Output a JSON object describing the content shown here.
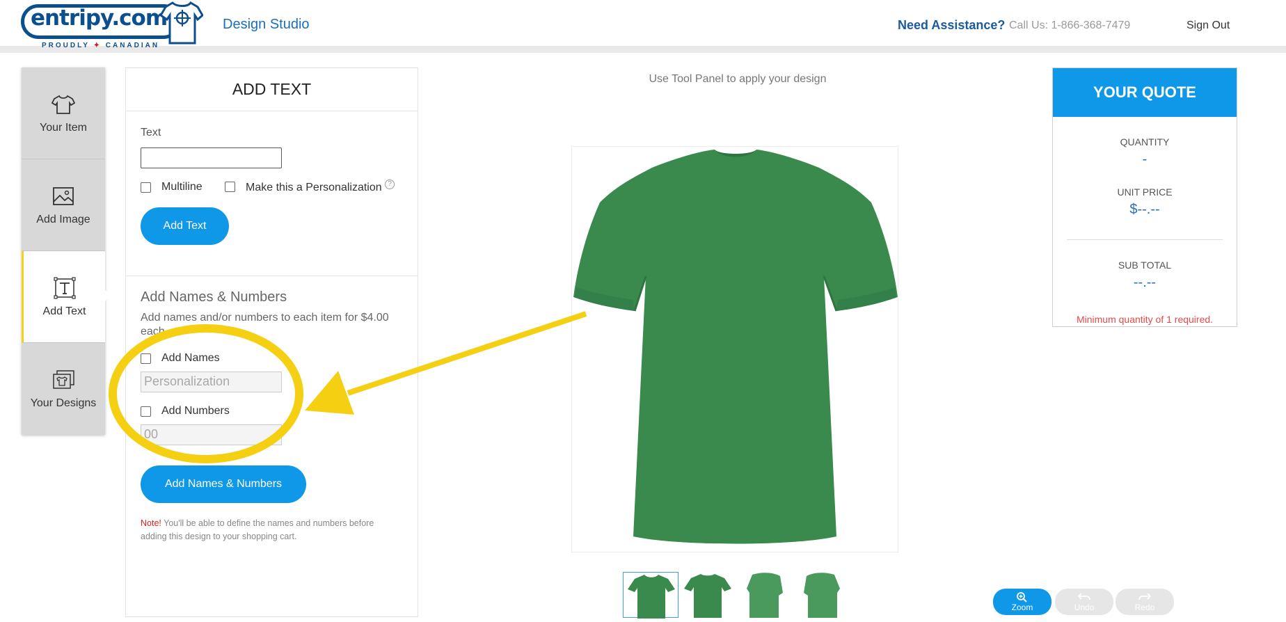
{
  "header": {
    "logo_text": "entripy.com",
    "logo_sub_left": "PROUDLY",
    "logo_sub_right": "CANADIAN",
    "studio_title": "Design Studio",
    "assistance": "Need Assistance?",
    "call_us": "Call Us: 1-866-368-7479",
    "sign_out": "Sign Out"
  },
  "sidebar": {
    "items": [
      {
        "label": "Your Item",
        "icon": "tshirt-icon"
      },
      {
        "label": "Add Image",
        "icon": "image-icon"
      },
      {
        "label": "Add Text",
        "icon": "text-icon",
        "active": true
      },
      {
        "label": "Your Designs",
        "icon": "designs-icon"
      }
    ]
  },
  "add_text": {
    "title": "ADD TEXT",
    "text_label": "Text",
    "text_value": "",
    "multiline_label": "Multiline",
    "personalization_label": "Make this a Personalization",
    "help": "?",
    "add_text_button": "Add Text",
    "names_numbers_title": "Add Names & Numbers",
    "names_numbers_desc": "Add names and/or numbers to each item for $4.00 each",
    "add_names_label": "Add Names",
    "names_placeholder": "Personalization",
    "add_numbers_label": "Add Numbers",
    "numbers_placeholder": "00",
    "add_names_numbers_button": "Add Names & Numbers",
    "note_label": "Note!",
    "note_text": " You'll be able to define the names and numbers before adding this design to your shopping cart."
  },
  "canvas": {
    "hint": "Use Tool Panel to apply your design",
    "shirt_color": "#3a8a4d",
    "thumbnails": [
      "front",
      "back",
      "left-sleeve",
      "right-sleeve"
    ],
    "selected_thumbnail": "front"
  },
  "quote": {
    "title": "YOUR QUOTE",
    "quantity_label": "QUANTITY",
    "quantity_value": "-",
    "unit_price_label": "UNIT PRICE",
    "unit_price_value": "$--.--",
    "subtotal_label": "SUB TOTAL",
    "subtotal_value": "--.--",
    "min_message": "Minimum quantity of 1 required."
  },
  "controls": {
    "zoom": "Zoom",
    "undo": "Undo",
    "redo": "Redo"
  },
  "colors": {
    "accent": "#0f97e8",
    "brand": "#0b4f8f",
    "annotation": "#f4cf12"
  }
}
